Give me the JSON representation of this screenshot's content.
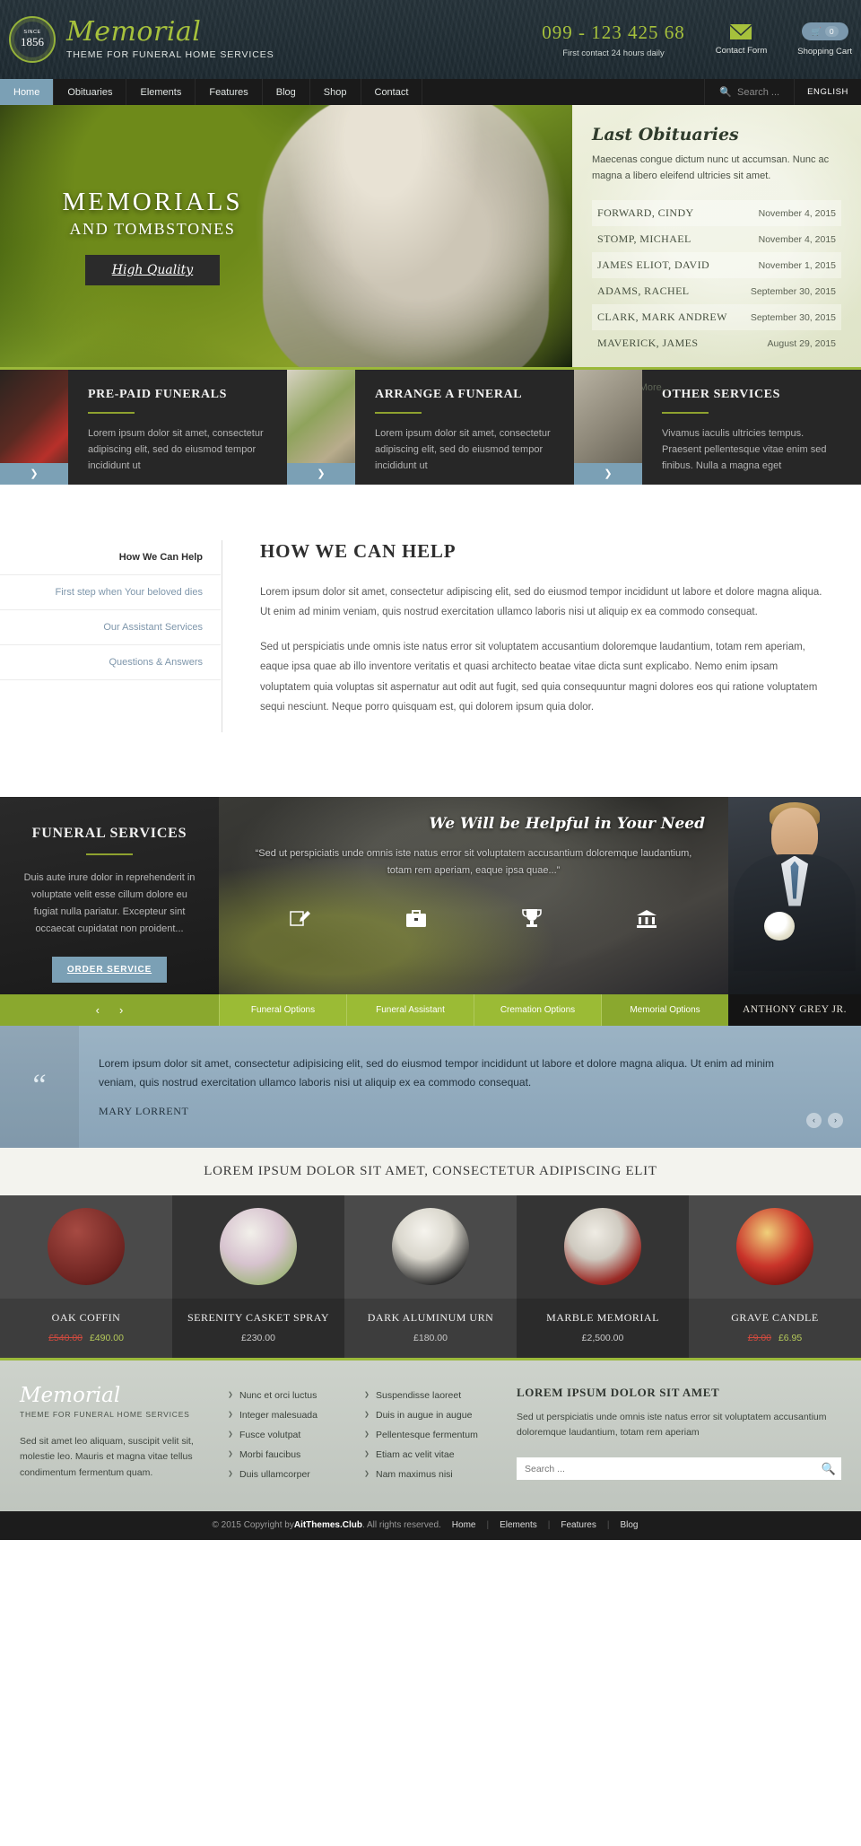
{
  "header": {
    "badge_since": "SINCE",
    "badge_year": "1856",
    "brand_name": "Memorial",
    "brand_tagline": "THEME FOR FUNERAL HOME SERVICES",
    "phone": "099 - 123 425 68",
    "phone_note": "First contact 24 hours daily",
    "contact_form_label": "Contact Form",
    "cart_label": "Shopping Cart",
    "cart_count": "0",
    "accent_green": "#a6c13c",
    "dark_bg": "#232f36"
  },
  "nav": {
    "items": [
      {
        "label": "Home",
        "active": true
      },
      {
        "label": "Obituaries",
        "active": false
      },
      {
        "label": "Elements",
        "active": false
      },
      {
        "label": "Features",
        "active": false
      },
      {
        "label": "Blog",
        "active": false
      },
      {
        "label": "Shop",
        "active": false
      },
      {
        "label": "Contact",
        "active": false
      }
    ],
    "search_placeholder": "Search ...",
    "language": "ENGLISH"
  },
  "hero": {
    "title": "MEMORIALS",
    "subtitle": "AND TOMBSTONES",
    "button": "High Quality"
  },
  "obituaries": {
    "title": "Last Obituaries",
    "intro": "Maecenas congue dictum nunc ut accumsan. Nunc ac magna a libero eleifend ultricies sit amet.",
    "rows": [
      {
        "name": "FORWARD, CINDY",
        "date": "November 4, 2015"
      },
      {
        "name": "STOMP, MICHAEL",
        "date": "November 4, 2015"
      },
      {
        "name": "JAMES ELIOT, DAVID",
        "date": "November 1, 2015"
      },
      {
        "name": "ADAMS, RACHEL",
        "date": "September 30, 2015"
      },
      {
        "name": "CLARK, MARK ANDREW",
        "date": "September 30, 2015"
      },
      {
        "name": "MAVERICK, JAMES",
        "date": "August 29, 2015"
      }
    ],
    "view_more": "View More..."
  },
  "service_boxes": [
    {
      "title": "PRE-PAID FUNERALS",
      "text": "Lorem ipsum dolor sit amet, consectetur adipiscing elit, sed do eiusmod tempor incididunt ut",
      "arrow": "❯"
    },
    {
      "title": "ARRANGE A FUNERAL",
      "text": "Lorem ipsum dolor sit amet, consectetur adipiscing elit, sed do eiusmod tempor incididunt ut",
      "arrow": "❯"
    },
    {
      "title": "OTHER SERVICES",
      "text": "Vivamus iaculis ultricies tempus. Praesent pellentesque vitae enim sed finibus. Nulla a magna eget",
      "arrow": "❯"
    }
  ],
  "help": {
    "tabs": [
      {
        "label": "How We Can Help",
        "active": true
      },
      {
        "label": "First step when Your beloved dies",
        "active": false
      },
      {
        "label": "Our Assistant Services",
        "active": false
      },
      {
        "label": "Questions & Answers",
        "active": false
      }
    ],
    "heading": "HOW WE CAN HELP",
    "p1": "Lorem ipsum dolor sit amet, consectetur adipiscing elit, sed do eiusmod tempor incididunt ut labore et dolore magna aliqua. Ut enim ad minim veniam, quis nostrud exercitation ullamco laboris nisi ut aliquip ex ea commodo consequat.",
    "p2": "Sed ut perspiciatis unde omnis iste natus error sit voluptatem accusantium doloremque laudantium, totam rem aperiam, eaque ipsa quae ab illo inventore veritatis et quasi architecto beatae vitae dicta sunt explicabo. Nemo enim ipsam voluptatem quia voluptas sit aspernatur aut odit aut fugit, sed quia consequuntur magni dolores eos qui ratione voluptatem sequi nesciunt. Neque porro quisquam est, qui dolorem ipsum quia dolor."
  },
  "funeral_services": {
    "title": "FUNERAL SERVICES",
    "text": "Duis aute irure dolor in reprehenderit in voluptate velit esse cillum dolore eu fugiat nulla pariatur. Excepteur sint occaecat cupidatat non proident...",
    "button": "ORDER SERVICE",
    "slide_title": "We Will be Helpful in Your Need",
    "slide_quote": "“Sed ut perspiciatis unde omnis iste natus error sit voluptatem accusantium doloremque laudantium, totam rem aperiam, eaque ipsa quae...”",
    "icons": [
      "pencil-icon",
      "briefcase-icon",
      "trophy-icon",
      "bank-icon"
    ],
    "person_name": "ANTHONY GREY JR."
  },
  "tabbar": {
    "prev": "‹",
    "next": "›",
    "tabs": [
      {
        "label": "Funeral Options",
        "active": false
      },
      {
        "label": "Funeral Assistant",
        "active": false
      },
      {
        "label": "Cremation Options",
        "active": false
      },
      {
        "label": "Memorial Options",
        "active": true
      }
    ]
  },
  "testimonial": {
    "quote_mark": "“",
    "text": "Lorem ipsum dolor sit amet, consectetur adipisicing elit, sed do eiusmod tempor incididunt ut labore et dolore magna aliqua. Ut enim ad minim veniam, quis nostrud exercitation ullamco laboris nisi ut aliquip ex ea commodo consequat.",
    "author": "MARY LORRENT",
    "prev": "‹",
    "next": "›"
  },
  "products": {
    "heading": "LOREM IPSUM DOLOR SIT AMET, CONSECTETUR ADIPISCING ELIT",
    "items": [
      {
        "name": "OAK COFFIN",
        "old_price": "£540.00",
        "price": "£490.00",
        "on_sale": true
      },
      {
        "name": "SERENITY CASKET SPRAY",
        "old_price": "",
        "price": "£230.00",
        "on_sale": false
      },
      {
        "name": "DARK ALUMINUM URN",
        "old_price": "",
        "price": "£180.00",
        "on_sale": false
      },
      {
        "name": "MARBLE MEMORIAL",
        "old_price": "",
        "price": "£2,500.00",
        "on_sale": false
      },
      {
        "name": "GRAVE CANDLE",
        "old_price": "£9.00",
        "price": "£6.95",
        "on_sale": true
      }
    ]
  },
  "footer": {
    "brand_name": "Memorial",
    "brand_tagline": "THEME FOR FUNERAL HOME SERVICES",
    "about": "Sed sit amet leo aliquam, suscipit velit sit, molestie leo. Mauris et magna vitae tellus condimentum fermentum quam.",
    "links_col1": [
      "Nunc et orci luctus",
      "Integer malesuada",
      "Fusce volutpat",
      "Morbi faucibus",
      "Duis ullamcorper"
    ],
    "links_col2": [
      "Suspendisse laoreet",
      "Duis in augue in augue",
      "Pellentesque fermentum",
      "Etiam ac velit vitae",
      "Nam maximus nisi"
    ],
    "col4_title": "LOREM IPSUM DOLOR SIT AMET",
    "col4_text": "Sed ut perspiciatis unde omnis iste natus error sit voluptatem accusantium doloremque laudantium, totam rem aperiam",
    "search_placeholder": "Search ..."
  },
  "copyright": {
    "prefix": "© 2015 Copyright by ",
    "brand": "AitThemes.Club",
    "suffix": ". All rights reserved.",
    "links": [
      "Home",
      "Elements",
      "Features",
      "Blog"
    ]
  }
}
